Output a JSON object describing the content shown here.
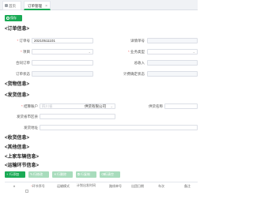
{
  "tabs": {
    "home": "首页",
    "order": "订单管理",
    "close": "×"
  },
  "toolbar": {
    "save": "保存"
  },
  "sections": {
    "order": "<订单信息>",
    "goods": "<货物信息>",
    "shipping": "<发货信息>",
    "receiving": "<收货信息>",
    "other": "<其他信息>",
    "loading": "<上家车辆信息>",
    "transport": "<运输环节信息>"
  },
  "order_form": {
    "order_no_label": "订单号",
    "order_no_value": "20210511101",
    "project_label": "项目",
    "project_value": "",
    "contract_label": "合同订单",
    "contract_value": "",
    "order_status_label": "订单状态",
    "order_status_value": "",
    "detail_no_label": "详情单号",
    "business_type_label": "业务类型",
    "business_type_value": "",
    "total_income_label": "总收入",
    "billing_status_label": "计费确定状态"
  },
  "ship_form": {
    "customer_label": "结算账户",
    "customer_value": "四川省",
    "company_suffix": "供货有限公司",
    "supplier_label": "供货名称",
    "address_label": "发货省市区县",
    "detail_addr_label": "发货地址"
  },
  "table_toolbar": {
    "add": "行添加",
    "edit": "行修改",
    "delete": "行删除",
    "copy": "行复制",
    "clear": "行清空"
  },
  "table_headers": {
    "index": "#",
    "segment_no": "环节序号",
    "transport_mode": "运输模式",
    "planned_departure": "计划出发时间",
    "route_no": "路线单号",
    "depart_date": "出团日期",
    "vehicle": "车次",
    "remark": "备注"
  }
}
